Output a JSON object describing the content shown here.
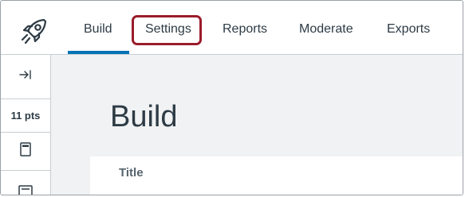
{
  "nav": {
    "tabs": [
      {
        "label": "Build"
      },
      {
        "label": "Settings"
      },
      {
        "label": "Reports"
      },
      {
        "label": "Moderate"
      },
      {
        "label": "Exports"
      }
    ],
    "active_tab": "Build",
    "highlighted_tab": "Settings",
    "logo_icon": "rocket-icon"
  },
  "sidebar": {
    "collapse_icon": "expand-sidebar-icon",
    "points": "11 pts",
    "item_icons": [
      "question-block-icon",
      "content-block-icon"
    ]
  },
  "main": {
    "heading": "Build",
    "card_label": "Title"
  },
  "colors": {
    "accent": "#0374b5",
    "highlight": "#9b1c2b",
    "text": "#2d3b45",
    "background": "#f1f2f3"
  }
}
